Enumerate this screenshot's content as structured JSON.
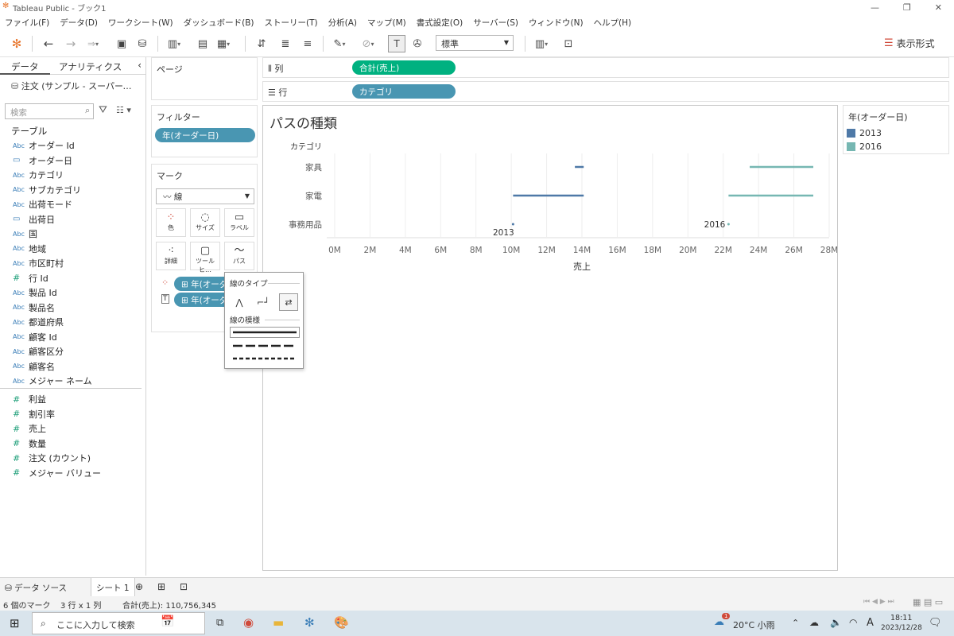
{
  "window": {
    "title": "Tableau Public - ブック1"
  },
  "menu": [
    "ファイル(F)",
    "データ(D)",
    "ワークシート(W)",
    "ダッシュボード(B)",
    "ストーリー(T)",
    "分析(A)",
    "マップ(M)",
    "書式設定(O)",
    "サーバー(S)",
    "ウィンドウ(N)",
    "ヘルプ(H)"
  ],
  "toolbar": {
    "fit_value": "標準",
    "show_me_label": "表示形式"
  },
  "data_pane": {
    "tabs": [
      "データ",
      "アナリティクス"
    ],
    "datasource": "注文 (サンプル - スーパーストア)",
    "search_placeholder": "検索",
    "table_header": "テーブル",
    "dimensions": [
      {
        "type": "Abc",
        "name": "オーダー Id"
      },
      {
        "type": "date",
        "name": "オーダー日"
      },
      {
        "type": "Abc",
        "name": "カテゴリ"
      },
      {
        "type": "Abc",
        "name": "サブカテゴリ"
      },
      {
        "type": "Abc",
        "name": "出荷モード"
      },
      {
        "type": "date",
        "name": "出荷日"
      },
      {
        "type": "Abc",
        "name": "国"
      },
      {
        "type": "Abc",
        "name": "地域"
      },
      {
        "type": "Abc",
        "name": "市区町村"
      },
      {
        "type": "#",
        "name": "行 Id"
      },
      {
        "type": "Abc",
        "name": "製品 Id"
      },
      {
        "type": "Abc",
        "name": "製品名"
      },
      {
        "type": "Abc",
        "name": "都道府県"
      },
      {
        "type": "Abc",
        "name": "顧客 Id"
      },
      {
        "type": "Abc",
        "name": "顧客区分"
      },
      {
        "type": "Abc",
        "name": "顧客名"
      },
      {
        "type": "Abc",
        "name": "メジャー ネーム"
      }
    ],
    "measures": [
      {
        "type": "#",
        "name": "利益"
      },
      {
        "type": "#",
        "name": "割引率"
      },
      {
        "type": "#",
        "name": "売上"
      },
      {
        "type": "#",
        "name": "数量"
      },
      {
        "type": "#",
        "name": "注文 (カウント)"
      },
      {
        "type": "#",
        "name": "メジャー バリュー"
      }
    ]
  },
  "cards": {
    "pages": "ページ",
    "filters": "フィルター",
    "filter_pill": "年(オーダー日)",
    "marks": "マーク",
    "mark_type": "線",
    "mark_buttons": [
      "色",
      "サイズ",
      "ラベル",
      "詳細",
      "ツールヒ…",
      "パス"
    ],
    "mark_pills": [
      "年(オーダー日)",
      "年(オーダー日)"
    ]
  },
  "shelves": {
    "columns_label": "列",
    "columns_pill": "合計(売上)",
    "rows_label": "行",
    "rows_pill": "カテゴリ"
  },
  "popup": {
    "line_type_title": "線のタイプ",
    "line_pattern_title": "線の模様"
  },
  "legend": {
    "title": "年(オーダー日)",
    "items": [
      {
        "name": "2013",
        "color": "#4e79a7"
      },
      {
        "name": "2016",
        "color": "#76b7b2"
      }
    ]
  },
  "chart_data": {
    "type": "line",
    "title": "パスの種類",
    "row_header": "カテゴリ",
    "xlabel": "売上",
    "categories": [
      "家具",
      "家電",
      "事務用品"
    ],
    "xlim": [
      0,
      28000000
    ],
    "xticks": [
      "0M",
      "2M",
      "4M",
      "6M",
      "8M",
      "10M",
      "12M",
      "14M",
      "16M",
      "18M",
      "20M",
      "22M",
      "24M",
      "26M",
      "28M"
    ],
    "series": [
      {
        "name": "2013",
        "color": "#4e79a7",
        "segments": [
          {
            "category": "家具",
            "x": [
              13600000,
              14100000
            ]
          },
          {
            "category": "家電",
            "x": [
              10100000,
              14100000
            ]
          },
          {
            "category": "事務用品",
            "x": [
              10100000,
              10100000
            ]
          }
        ]
      },
      {
        "name": "2016",
        "color": "#76b7b2",
        "segments": [
          {
            "category": "家具",
            "x": [
              23500000,
              27100000
            ]
          },
          {
            "category": "家電",
            "x": [
              22300000,
              27100000
            ]
          },
          {
            "category": "事務用品",
            "x": [
              22300000,
              22300000
            ]
          }
        ]
      }
    ],
    "annotations": [
      {
        "text": "2013",
        "category": "事務用品",
        "x": 10100000
      },
      {
        "text": "2016",
        "category": "事務用品",
        "x": 22300000
      }
    ],
    "grid": true
  },
  "sheet_tabs": {
    "datasource": "データ ソース",
    "sheet": "シート 1"
  },
  "status": {
    "marks": "6 個のマーク",
    "dims": "3 行 x 1 列",
    "sum": "合計(売上): 110,756,345"
  },
  "taskbar": {
    "search_placeholder": "ここに入力して検索",
    "weather": "20°C 小雨",
    "ime": "A",
    "time": "18:11",
    "date": "2023/12/28",
    "weather_badge": "1"
  }
}
